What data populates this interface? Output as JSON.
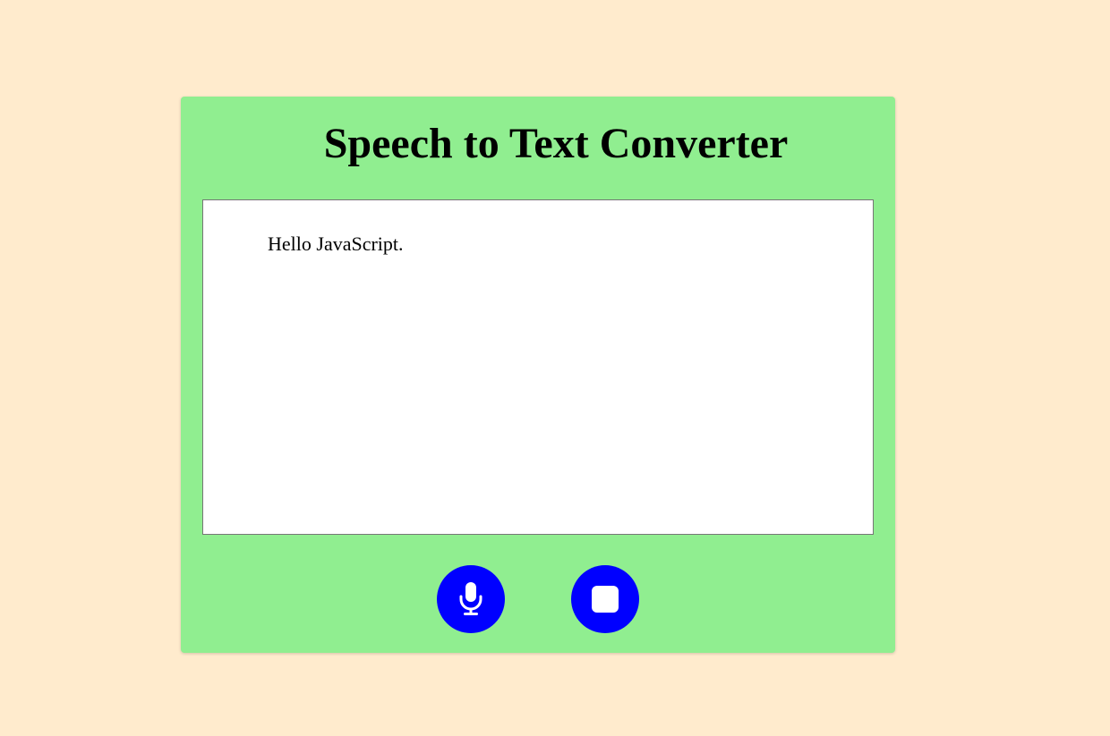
{
  "page": {
    "background_color": "#ffebcd"
  },
  "card": {
    "background_color": "#90ee90",
    "title": "Speech to Text Converter"
  },
  "transcript": {
    "text": "Hello JavaScript."
  },
  "controls": {
    "button_color": "#0000ff",
    "icon_color": "#ffffff",
    "start_icon": "microphone-icon",
    "stop_icon": "stop-icon"
  }
}
